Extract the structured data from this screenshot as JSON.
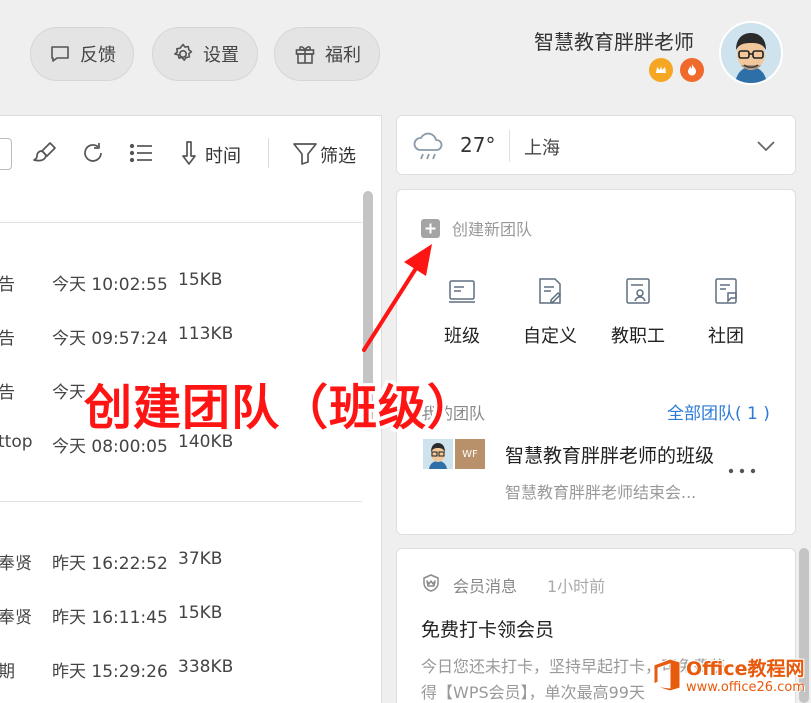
{
  "top_bar": {
    "feedback_label": "反馈",
    "settings_label": "设置",
    "benefits_label": "福利",
    "user_name": "智慧教育胖胖老师"
  },
  "file_panel": {
    "toolbar": {
      "time_label": "时间",
      "filter_label": "筛选"
    },
    "rows": [
      {
        "name": "告",
        "time": "今天 10:02:55",
        "size": "15KB"
      },
      {
        "name": "告",
        "time": "今天 09:57:24",
        "size": "113KB"
      },
      {
        "name": "告",
        "time": "今天",
        "size": ""
      },
      {
        "name": "ttop",
        "time": "今天 08:00:05",
        "size": "140KB"
      },
      {
        "name": "奉贤",
        "time": "昨天 16:22:52",
        "size": "37KB"
      },
      {
        "name": "奉贤",
        "time": "昨天 16:11:45",
        "size": "15KB"
      },
      {
        "name": "期",
        "time": "昨天 15:29:26",
        "size": "338KB"
      }
    ]
  },
  "weather": {
    "temperature": "27°",
    "city": "上海"
  },
  "team_card": {
    "create_label": "创建新团队",
    "types": [
      {
        "label": "班级",
        "icon": "class-icon"
      },
      {
        "label": "自定义",
        "icon": "custom-icon"
      },
      {
        "label": "教职工",
        "icon": "staff-icon"
      },
      {
        "label": "社团",
        "icon": "club-icon"
      }
    ],
    "my_teams_label": "我的团队",
    "all_teams_label": "全部团队( 1 )",
    "team_name": "智慧教育胖胖老师的班级",
    "team_desc": "智慧教育胖胖老师结束会...",
    "team_avatar_text": "WF"
  },
  "message_card": {
    "type_label": "会员消息",
    "time_ago": "1小时前",
    "title": "免费打卡领会员",
    "body_line1": "今日您还未打卡，坚持早起打卡，可免费获",
    "body_line2": "得【WPS会员】，单次最高99天"
  },
  "annotation": {
    "text": "创建团队（班级）"
  },
  "watermark": {
    "brand": "Office教程网",
    "url": "www.office26.com"
  },
  "colors": {
    "accent_blue": "#2b7ad6",
    "annotation_red": "#ff1414",
    "watermark_orange": "#e85a0c"
  }
}
